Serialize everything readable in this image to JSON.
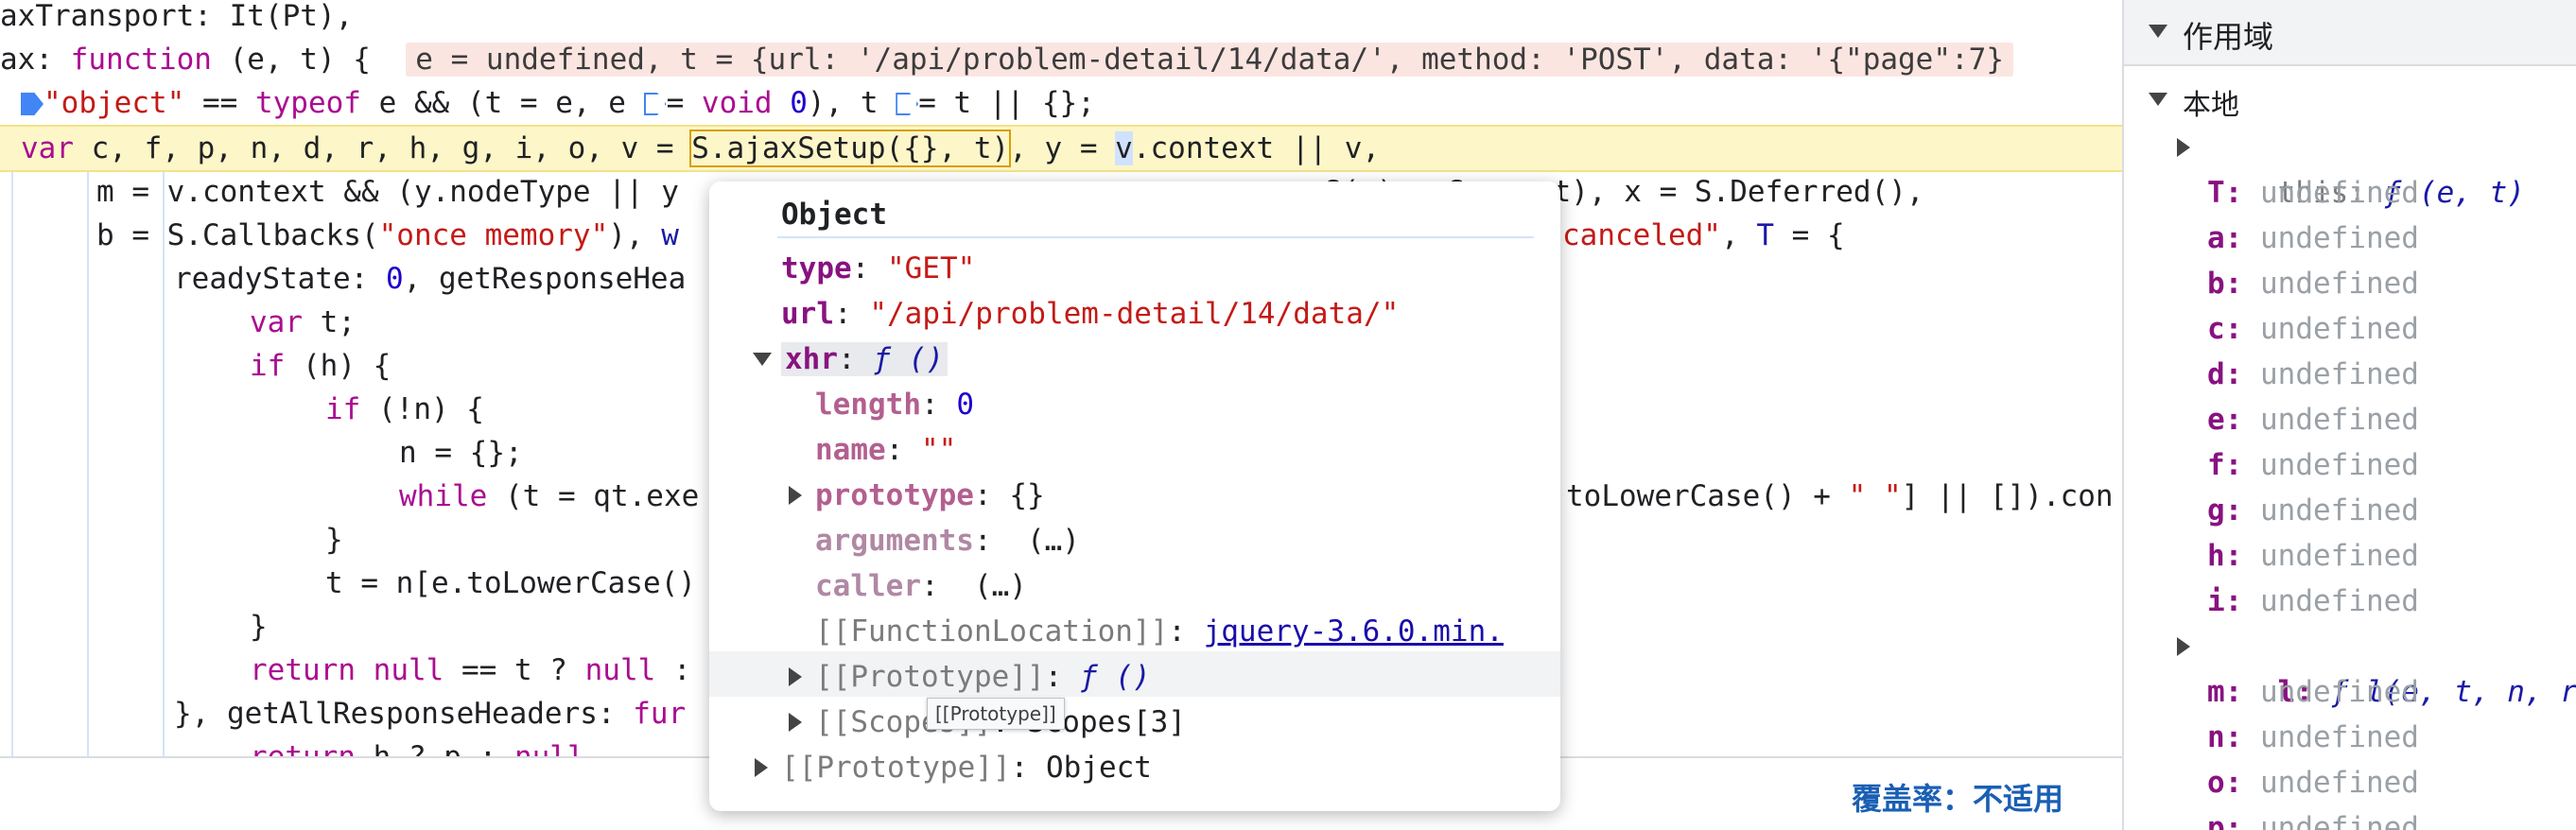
{
  "editor": {
    "line1": {
      "text": "axTransport: It(Pt),"
    },
    "line2": {
      "a": "ax: ",
      "kw": "function",
      "b": " (e, t) {  ",
      "inline": "e = undefined, t = {url: '/api/problem-detail/14/data/', method: 'POST', data: '{\"page\":7}"
    },
    "line3": {
      "str": "\"object\"",
      "a": " == ",
      "kw": "typeof",
      "b": " e && (t = e, e ",
      "c": "= ",
      "kw2": "void",
      "num": "0",
      "d": "), t ",
      "e": "= t || {};"
    },
    "line4": {
      "kw": "var",
      "vars": " c, f, p, n, d, r, h, g, i, o, v = ",
      "boxed": "S.ajaxSetup({}, t)",
      "b": ", y = ",
      "cur": "v",
      "c": ".context || v,"
    },
    "line5": {
      "text": "m = v.context && (y.nodeType || y"
    },
    "line5b": {
      "text": "S(y) : S.event), x = S.Deferred(),"
    },
    "line6": {
      "a": "b = S.Callbacks(",
      "str": "\"once memory\"",
      "b": "), ",
      "c": "w",
      "str2": "canceled\"",
      "d": ", ",
      "e": "T",
      "f": " = {"
    },
    "line7": {
      "a": "readyState: ",
      "num": "0",
      "b": ", getResponseHea"
    },
    "line8": {
      "kw": "var",
      "a": " t;"
    },
    "line9": {
      "kw": "if",
      "a": " (h) {"
    },
    "line10": {
      "kw": "if",
      "a": " (!n) {"
    },
    "line11": {
      "text": "n = {};"
    },
    "line12": {
      "kw": "while",
      "a": " (t = qt.exe",
      "b": "toLowerCase() + ",
      "str": "\" \"",
      "c": "] || []).con"
    },
    "line13": {
      "text": "}"
    },
    "line14": {
      "text": "t = n[e.toLowerCase()"
    },
    "line15": {
      "text": "}"
    },
    "line16": {
      "kw": "return",
      "a": " ",
      "kw2": "null",
      "b": " == t ? ",
      "kw3": "null",
      "c": " :"
    },
    "line17": {
      "a": "}, getAllResponseHeaders: ",
      "kw": "fur"
    },
    "line18": {
      "kw": "return",
      "a": " h ? p : ",
      "kw2": "null"
    },
    "coverage": "覆盖率：不适用"
  },
  "popover": {
    "title": "Object",
    "type_key": "type",
    "type_val": "\"GET\"",
    "url_key": "url",
    "url_val": "\"/api/problem-detail/14/data/\"",
    "xhr_key": "xhr",
    "xhr_val": "ƒ ()",
    "length_key": "length",
    "length_val": "0",
    "name_key": "name",
    "name_val": "\"\"",
    "prototype_key": "prototype",
    "prototype_val": "{}",
    "arguments_key": "arguments",
    "arguments_val": "(…)",
    "caller_key": "caller",
    "caller_val": "(…)",
    "funcloc_key": "[[FunctionLocation]]",
    "funcloc_val": "jquery-3.6.0.min.",
    "proto_key": "[[Prototype]]",
    "proto_val": "ƒ ()",
    "scopes_key": "[[Scopes]]",
    "scopes_val": "Scopes[3]",
    "outer_proto_key": "[[Prototype]]",
    "outer_proto_val": "Object",
    "tooltip": "[[Prototype]]"
  },
  "scope": {
    "title": "作用域",
    "local_label": "本地",
    "this_name": "this",
    "this_val": "ƒ (e, t)",
    "vars": [
      {
        "name": "T",
        "value": "undefined"
      },
      {
        "name": "a",
        "value": "undefined"
      },
      {
        "name": "b",
        "value": "undefined"
      },
      {
        "name": "c",
        "value": "undefined"
      },
      {
        "name": "d",
        "value": "undefined"
      },
      {
        "name": "e",
        "value": "undefined"
      },
      {
        "name": "f",
        "value": "undefined"
      },
      {
        "name": "g",
        "value": "undefined"
      },
      {
        "name": "h",
        "value": "undefined"
      },
      {
        "name": "i",
        "value": "undefined"
      }
    ],
    "l_name": "l",
    "l_val": "ƒ l(e, t, n, r)",
    "vars2": [
      {
        "name": "m",
        "value": "undefined"
      },
      {
        "name": "n",
        "value": "undefined"
      },
      {
        "name": "o",
        "value": "undefined"
      },
      {
        "name": "p",
        "value": "undefined"
      }
    ]
  },
  "colors": {
    "keyword": "#aa0d91",
    "string": "#c41a16",
    "number": "#1c00cf",
    "highlight": "#fdf6c8",
    "link": "#1a5fb4"
  }
}
